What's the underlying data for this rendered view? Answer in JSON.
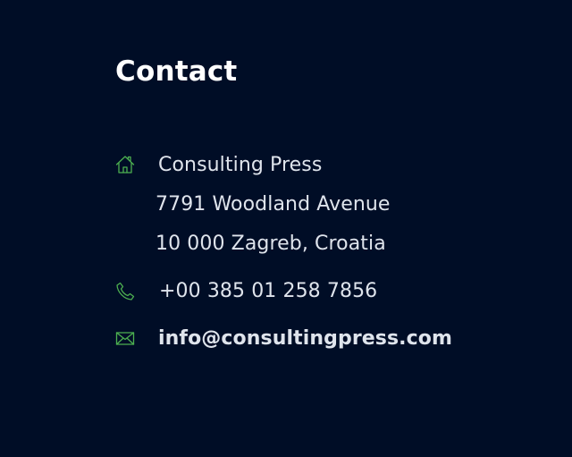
{
  "contact": {
    "title": "Contact",
    "address": {
      "icon": "home-icon",
      "company": "Consulting Press",
      "street": "7791 Woodland Avenue",
      "city": "10 000 Zagreb, Croatia"
    },
    "phone": {
      "icon": "phone-icon",
      "number": "+00 385 01 258 7856"
    },
    "email": {
      "icon": "mail-icon",
      "address": "info@consultingpress.com"
    }
  },
  "colors": {
    "background": "#000d26",
    "accent": "#4caf50",
    "text": "#dfe4ec",
    "heading": "#ffffff"
  }
}
